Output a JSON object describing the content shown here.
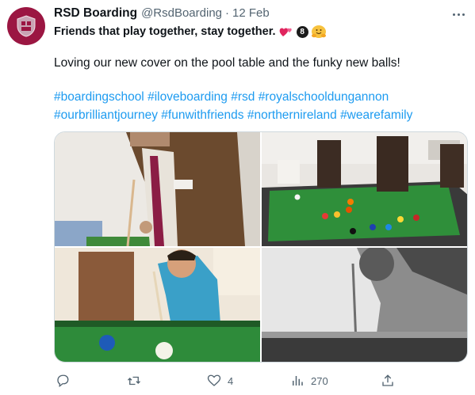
{
  "tweet": {
    "display_name": "RSD Boarding",
    "handle": "@RsdBoarding",
    "separator": "·",
    "date": "12 Feb",
    "headline": "Friends that play together, stay together.",
    "emoji_badge": "8",
    "body": "Loving our new cover on the pool table and the funky new balls!",
    "hashtags": [
      "#boardingschool",
      "#iloveboarding",
      "#rsd",
      "#royalschooldungannon",
      "#ourbrilliantjourney",
      "#funwithfriends",
      "#northernireland",
      "#wearefamily"
    ]
  },
  "media": {
    "photos": [
      {
        "label": "student-lining-up-pool-shot"
      },
      {
        "label": "students-around-pool-table"
      },
      {
        "label": "child-playing-pool"
      },
      {
        "label": "black-and-white-pool-shot"
      }
    ]
  },
  "actions": {
    "reply": {
      "icon": "reply-icon",
      "count": ""
    },
    "retweet": {
      "icon": "retweet-icon",
      "count": ""
    },
    "like": {
      "icon": "heart-icon",
      "count": "4"
    },
    "views": {
      "icon": "views-icon",
      "count": "270"
    },
    "share": {
      "icon": "share-icon",
      "count": ""
    }
  },
  "colors": {
    "accent": "#1d9bf0",
    "muted": "#536471",
    "avatar_bg": "#9b1642",
    "felt": "#2e7d32"
  }
}
